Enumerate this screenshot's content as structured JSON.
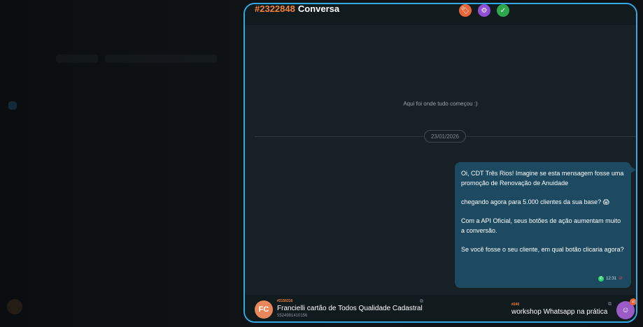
{
  "conversation": {
    "id": "#2322848",
    "title": "Conversa",
    "header_icons": [
      "tag-icon",
      "bot-icon",
      "check-icon"
    ]
  },
  "chat": {
    "intro_text": "Aqui foi onde tudo começou :)",
    "date_separator": "23/01/2026",
    "message": {
      "paragraphs": [
        "Oi, CDT Três Rios! Imagine se esta mensagem fosse uma promoção de Renovação de Anuidade",
        "chegando agora para 5.000 clientes da sua base? 😱",
        "Com a API Oficial, seus botões de ação aumentam muito a conversão.",
        "Se você fosse o seu cliente, em qual botão clicaria agora?"
      ],
      "time": "12:31",
      "status_icon": "error-icon"
    }
  },
  "footer": {
    "contact": {
      "initials": "FC",
      "id": "#2156316",
      "name": "Francielli cartão de Todos Qualidade Cadastral",
      "phone": "5524981410156"
    },
    "campaign": {
      "id": "#240",
      "name": "workshop Whatsapp na prática"
    }
  },
  "colors": {
    "accent_orange": "#f0833a",
    "panel_border": "#33a9e6",
    "bubble": "#1d4a60"
  }
}
